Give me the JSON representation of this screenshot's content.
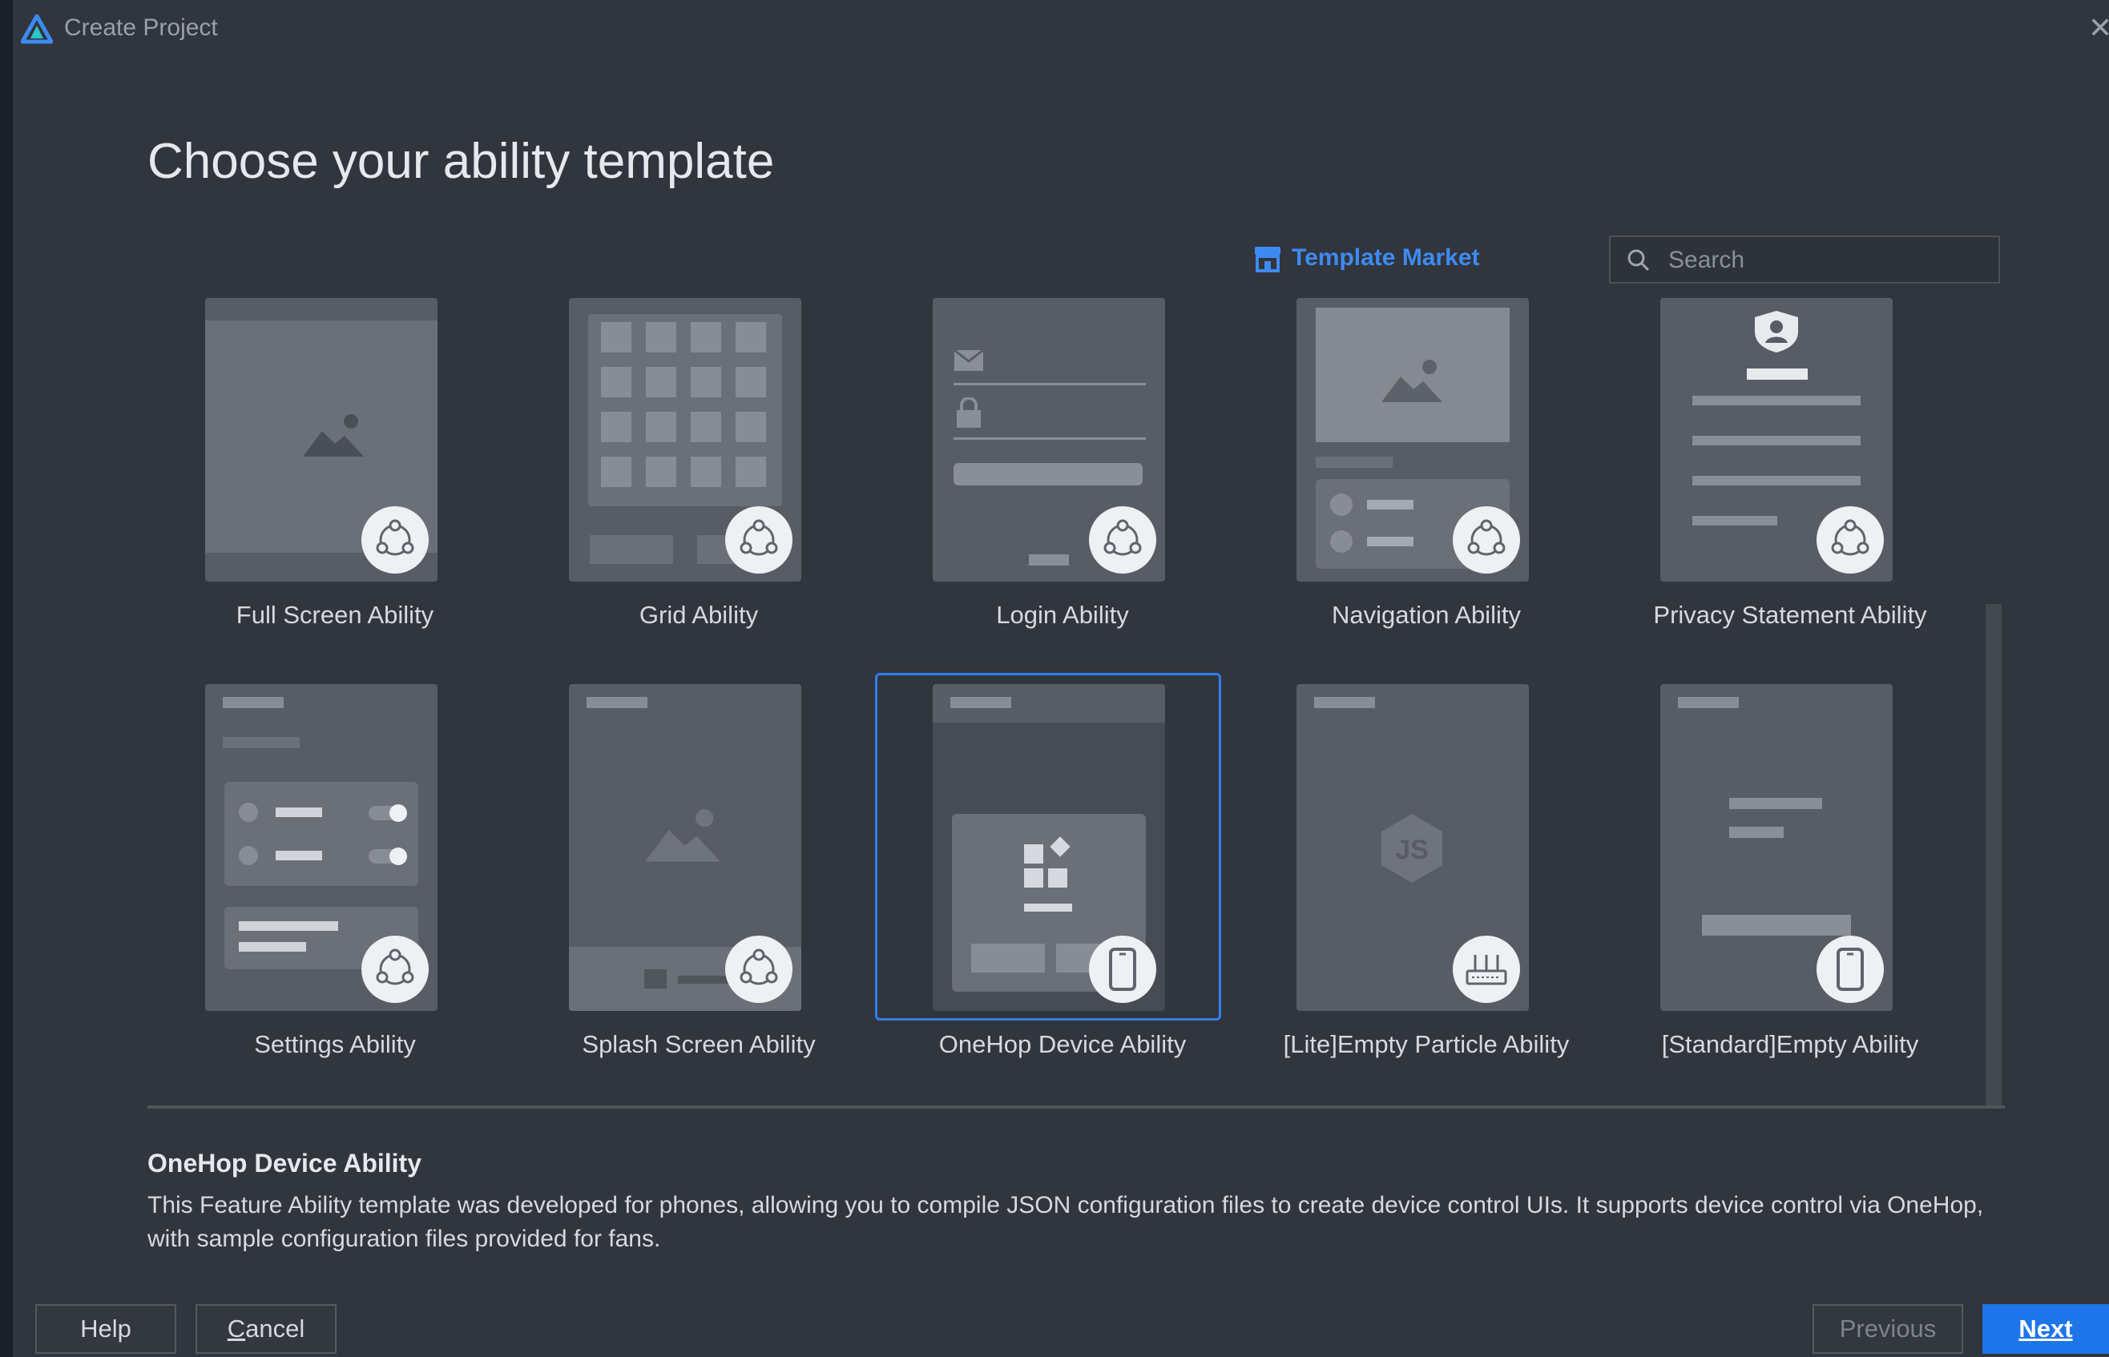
{
  "window": {
    "title": "Create Project",
    "close_symbol": "✕"
  },
  "heading": "Choose your ability template",
  "template_market": {
    "label": "Template Market"
  },
  "search": {
    "placeholder": "Search",
    "value": ""
  },
  "templates": [
    {
      "label": "Full Screen Ability",
      "badge_icon": "distributed-icon"
    },
    {
      "label": "Grid Ability",
      "badge_icon": "distributed-icon"
    },
    {
      "label": "Login Ability",
      "badge_icon": "distributed-icon"
    },
    {
      "label": "Navigation Ability",
      "badge_icon": "distributed-icon"
    },
    {
      "label": "Privacy Statement Ability",
      "badge_icon": "distributed-icon"
    },
    {
      "label": "Settings Ability",
      "badge_icon": "distributed-icon"
    },
    {
      "label": "Splash Screen Ability",
      "badge_icon": "distributed-icon"
    },
    {
      "label": "OneHop Device Ability",
      "badge_icon": "phone-icon",
      "selected": true
    },
    {
      "label": "[Lite]Empty Particle Ability",
      "badge_icon": "router-icon"
    },
    {
      "label": "[Standard]Empty Ability",
      "badge_icon": "phone-icon"
    }
  ],
  "selected": {
    "title": "OneHop Device Ability",
    "description": "This Feature Ability template was developed for phones, allowing you to compile JSON configuration files to create device control UIs. It supports device control via OneHop, with sample configuration files provided for fans."
  },
  "buttons": {
    "help": "Help",
    "cancel_mnemonic": "C",
    "cancel_rest": "ancel",
    "previous": "Previous",
    "next_mnemonic": "N",
    "next_rest": "ext"
  },
  "colors": {
    "accent": "#2f7ff2",
    "window_bg": "#31353d",
    "card_bg": "#585c65",
    "primary_button": "#1e75ea"
  }
}
